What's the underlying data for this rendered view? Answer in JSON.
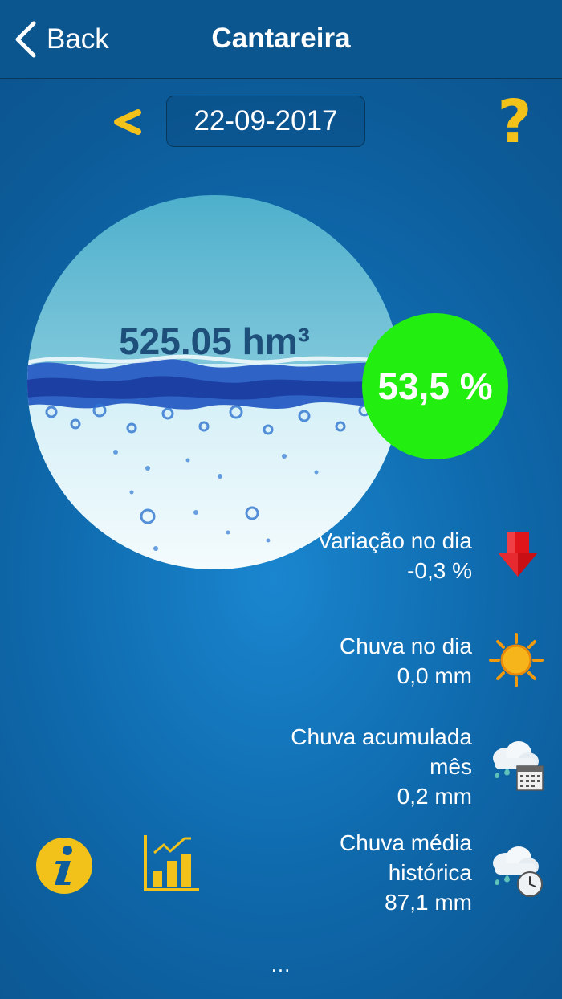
{
  "nav": {
    "back_label": "Back",
    "title": "Cantareira"
  },
  "date": {
    "value": "22-09-2017"
  },
  "reservoir": {
    "volume": "525.05 hm³",
    "percent": "53,5 %"
  },
  "stats": {
    "variation": {
      "label": "Variação no dia",
      "value": "-0,3 %"
    },
    "rain_day": {
      "label": "Chuva no dia",
      "value": "0,0 mm"
    },
    "rain_month": {
      "label_line1": "Chuva acumulada",
      "label_line2": "mês",
      "value": "0,2 mm"
    },
    "rain_avg": {
      "label_line1": "Chuva média",
      "label_line2": "histórica",
      "value": "87,1 mm"
    }
  },
  "more": "...",
  "colors": {
    "accent_yellow": "#f2c21a",
    "percent_green": "#22ee0f",
    "navbar": "#0c568f",
    "arrow_red": "#e0151a"
  },
  "icons": [
    "chevron-left-icon",
    "prev-date-icon",
    "help-icon",
    "down-arrow-icon",
    "sun-icon",
    "rain-calendar-icon",
    "rain-clock-icon",
    "info-icon",
    "chart-icon"
  ]
}
